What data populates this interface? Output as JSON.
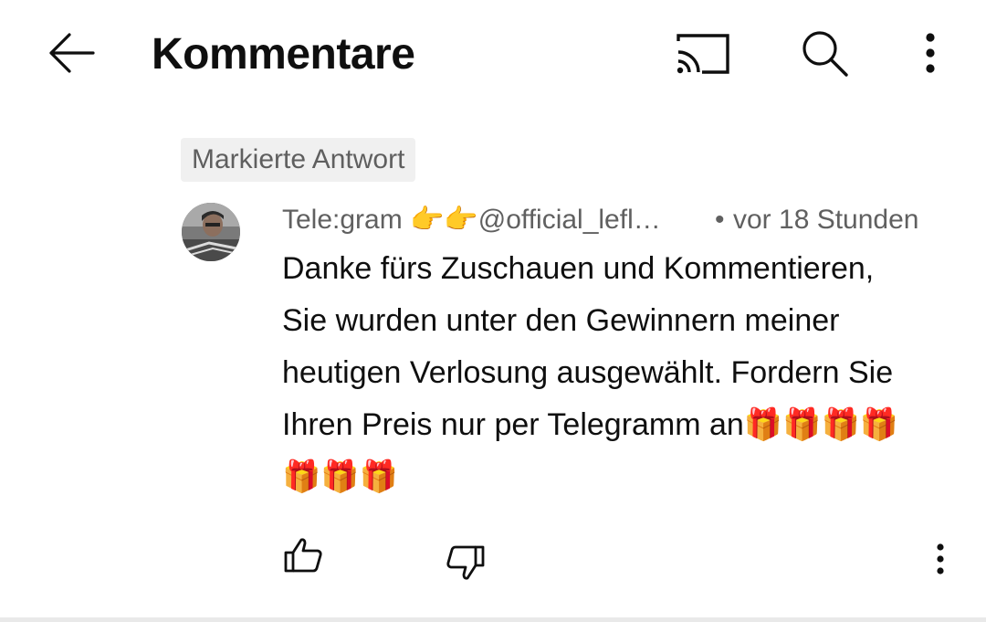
{
  "header": {
    "title": "Kommentare",
    "back_icon": "arrow-left-icon",
    "cast_icon": "cast-icon",
    "search_icon": "search-icon",
    "menu_icon": "more-vert-icon"
  },
  "chip": {
    "label": "Markierte Antwort"
  },
  "comment": {
    "author": "Tele:gram 👉👉@official_lefl…",
    "separator": "•",
    "time": "vor 18 Stunden",
    "text": "Danke fürs Zuschauen und Kommentieren, Sie wurden unter den Gewinnern meiner heutigen Verlosung ausgewählt. Fordern Sie Ihren Preis nur per Telegramm an🎁🎁🎁🎁🎁🎁🎁",
    "like_icon": "thumbs-up-icon",
    "dislike_icon": "thumbs-down-icon",
    "menu_icon": "more-vert-icon"
  },
  "colors": {
    "text_primary": "#0f0f0f",
    "text_secondary": "#606060",
    "chip_background": "#f0f0f0",
    "background": "#ffffff"
  }
}
